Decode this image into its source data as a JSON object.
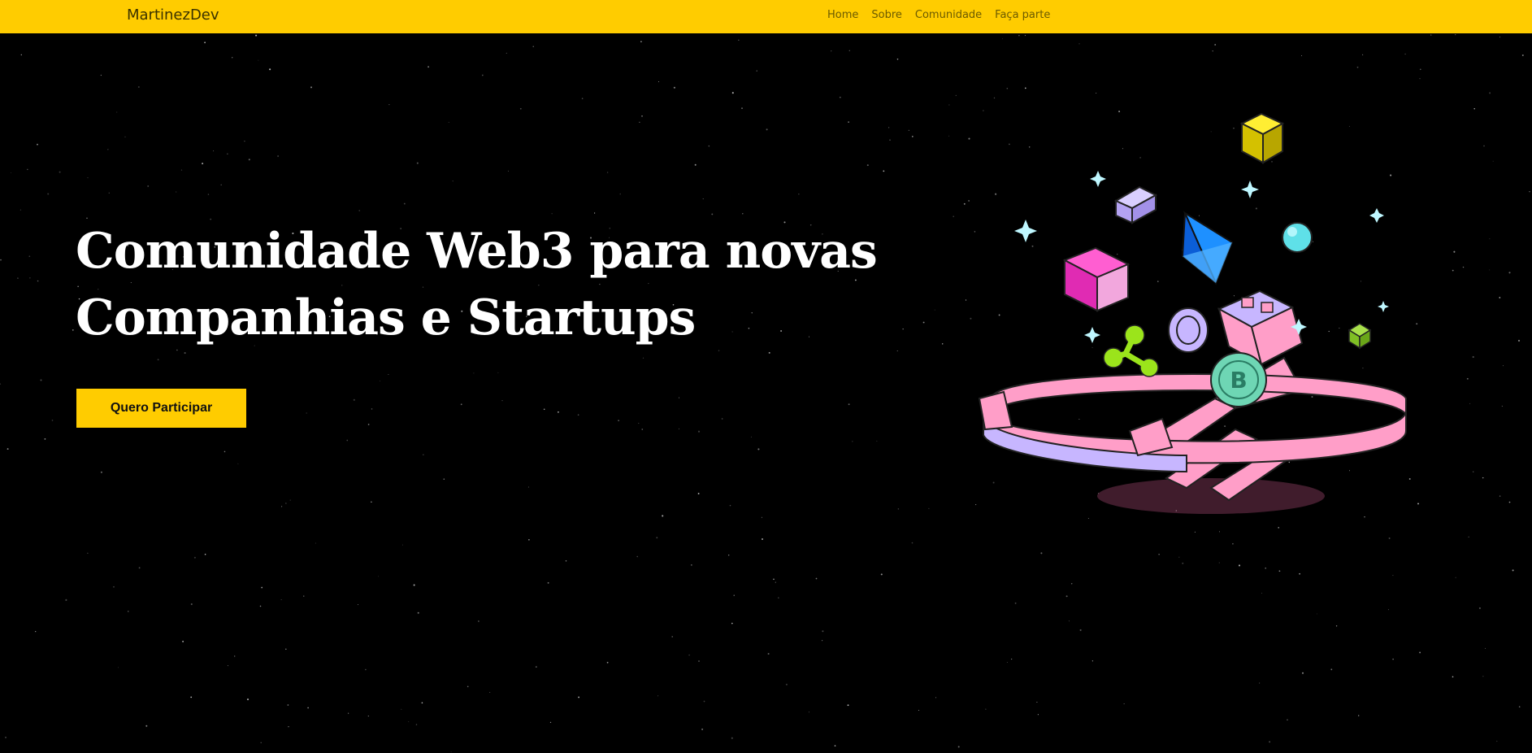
{
  "navbar": {
    "brand": "MartinezDev",
    "links": [
      {
        "label": "Home"
      },
      {
        "label": "Sobre"
      },
      {
        "label": "Comunidade"
      },
      {
        "label": "Faça parte"
      }
    ],
    "background": "#ffcc00"
  },
  "hero": {
    "title_line1": "Comunidade Web3 para novas",
    "title_line2": "Companhias e Startups",
    "cta_label": "Quero Participar",
    "background": "#000000",
    "accent": "#ffcc00"
  },
  "illustration": {
    "subject": "hands-holding-crypto-ring",
    "icons": [
      "ethereum-icon",
      "bitcoin-coin-icon",
      "ripple-icon",
      "chainlink-coin-icon",
      "cube-icon",
      "sparkle-icon",
      "orb-icon"
    ]
  }
}
